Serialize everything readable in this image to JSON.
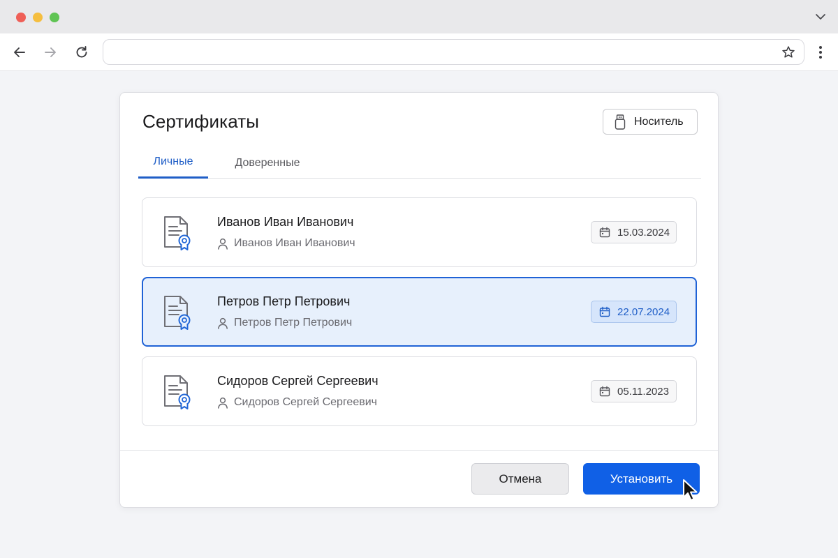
{
  "browser": {
    "address_value": "",
    "window_controls": [
      "close",
      "minimize",
      "maximize"
    ],
    "icons": {
      "back": "arrow-left-icon",
      "forward": "arrow-right-icon",
      "reload": "reload-icon",
      "bookmark": "star-icon",
      "menu": "kebab-menu-icon",
      "tabs_dropdown": "chevron-down-icon"
    }
  },
  "dialog": {
    "title": "Сертификаты",
    "carrier_button": {
      "label": "Носитель",
      "icon": "usb-drive-icon"
    },
    "tabs": [
      {
        "label": "Личные",
        "active": true
      },
      {
        "label": "Доверенные",
        "active": false
      }
    ],
    "certificates": [
      {
        "name": "Иванов Иван Иванович",
        "owner": "Иванов Иван Иванович",
        "date": "15.03.2024",
        "selected": false
      },
      {
        "name": "Петров Петр Петрович",
        "owner": "Петров Петр Петрович",
        "date": "22.07.2024",
        "selected": true
      },
      {
        "name": "Сидоров Сергей Сергеевич",
        "owner": "Сидоров Сергей Сергеевич",
        "date": "05.11.2023",
        "selected": false
      }
    ],
    "buttons": {
      "cancel": "Отмена",
      "install": "Установить"
    }
  },
  "colors": {
    "accent": "#1060e6",
    "selected_bg": "#e7f0fc",
    "cert_icon_badge": "#2368d8"
  }
}
